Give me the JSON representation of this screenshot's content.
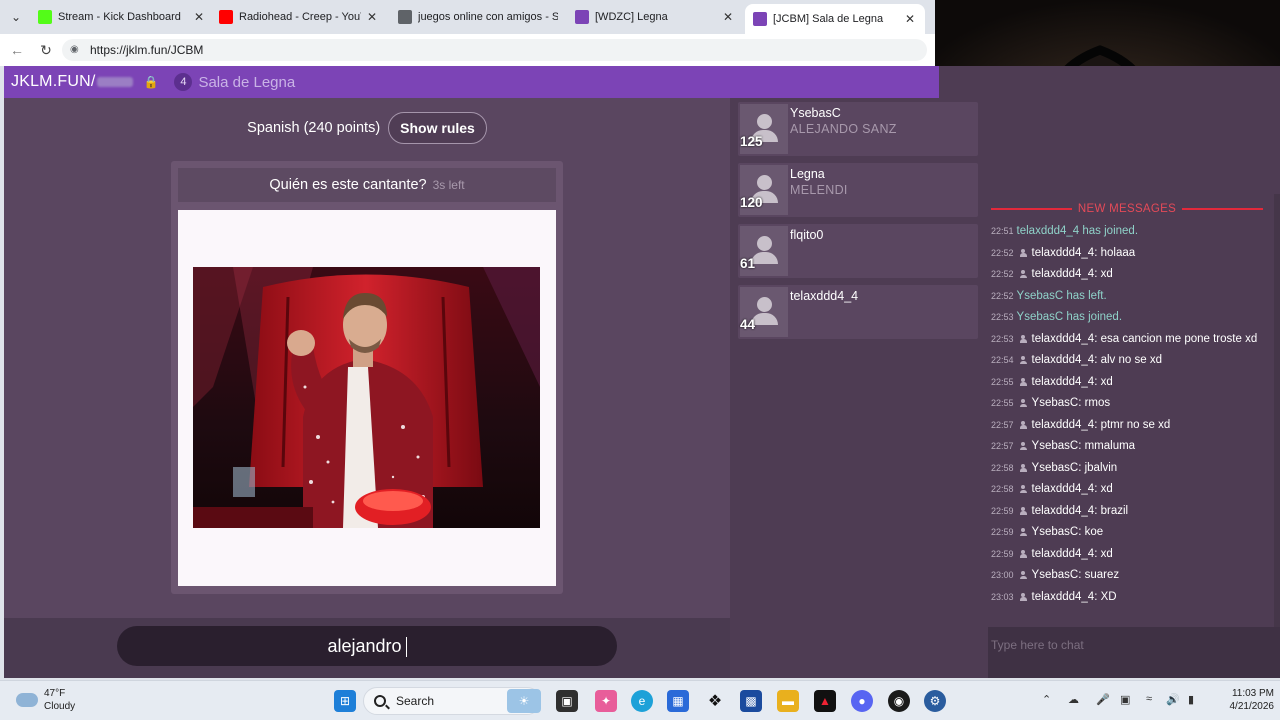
{
  "browser": {
    "tabs": [
      {
        "title": "Stream - Kick Dashboard",
        "icon": "kick-icon",
        "color": "#53fc18",
        "active": false
      },
      {
        "title": "Radiohead - Creep - YouTube",
        "icon": "youtube-icon",
        "color": "#ff0000",
        "active": false
      },
      {
        "title": "juegos online con amigos - Se",
        "icon": "search-icon",
        "color": "#5f6368",
        "active": false
      },
      {
        "title": "[WDZC] Legna",
        "icon": "jklm-icon",
        "color": "#7c44b6",
        "active": false
      },
      {
        "title": "[JCBM] Sala de Legna",
        "icon": "jklm-icon",
        "color": "#7c44b6",
        "active": true
      }
    ],
    "url": "https://jklm.fun/JCBM"
  },
  "header": {
    "logo": "JKLM.FUN/",
    "room_player_count": "4",
    "room_name": "Sala de Legna",
    "accent": "#7c44b6"
  },
  "game": {
    "dictionary": "Spanish (240 points)",
    "show_rules": "Show rules",
    "prompt": "Quién es este cantante?",
    "time_left": "3s left",
    "answer_text": "alejandro"
  },
  "players": [
    {
      "name": "YsebasC",
      "score": "125",
      "last_answer": "ALEJANDO SANZ"
    },
    {
      "name": "Legna",
      "score": "120",
      "last_answer": "MELENDI"
    },
    {
      "name": "flqito0",
      "score": "61",
      "last_answer": ""
    },
    {
      "name": "telaxddd4_4",
      "score": "44",
      "last_answer": ""
    }
  ],
  "chat": {
    "new_messages_label": "NEW MESSAGES",
    "placeholder": "Type here to chat",
    "messages": [
      {
        "time": "22:51",
        "system": true,
        "text": "telaxddd4_4 has joined."
      },
      {
        "time": "22:52",
        "system": false,
        "user": "telaxddd4_4",
        "text": "holaaa"
      },
      {
        "time": "22:52",
        "system": false,
        "user": "telaxddd4_4",
        "text": "xd"
      },
      {
        "time": "22:52",
        "system": true,
        "text": "YsebasC has left."
      },
      {
        "time": "22:53",
        "system": true,
        "text": "YsebasC has joined."
      },
      {
        "time": "22:53",
        "system": false,
        "user": "telaxddd4_4",
        "text": "esa cancion me pone troste xd"
      },
      {
        "time": "22:54",
        "system": false,
        "user": "telaxddd4_4",
        "text": "alv no se xd"
      },
      {
        "time": "22:55",
        "system": false,
        "user": "telaxddd4_4",
        "text": "xd"
      },
      {
        "time": "22:55",
        "system": false,
        "user": "YsebasC",
        "text": "rmos"
      },
      {
        "time": "22:57",
        "system": false,
        "user": "telaxddd4_4",
        "text": "ptmr no se xd"
      },
      {
        "time": "22:57",
        "system": false,
        "user": "YsebasC",
        "text": "mmaluma"
      },
      {
        "time": "22:58",
        "system": false,
        "user": "YsebasC",
        "text": "jbalvin"
      },
      {
        "time": "22:58",
        "system": false,
        "user": "telaxddd4_4",
        "text": "xd"
      },
      {
        "time": "22:59",
        "system": false,
        "user": "telaxddd4_4",
        "text": "brazil"
      },
      {
        "time": "22:59",
        "system": false,
        "user": "YsebasC",
        "text": "koe"
      },
      {
        "time": "22:59",
        "system": false,
        "user": "telaxddd4_4",
        "text": "xd"
      },
      {
        "time": "23:00",
        "system": false,
        "user": "YsebasC",
        "text": "suarez"
      },
      {
        "time": "23:03",
        "system": false,
        "user": "telaxddd4_4",
        "text": "XD"
      }
    ]
  },
  "taskbar": {
    "weather_temp": "47°F",
    "weather_desc": "Cloudy",
    "search_label": "Search",
    "time": "11:03 PM",
    "date": "4/21/2026"
  }
}
